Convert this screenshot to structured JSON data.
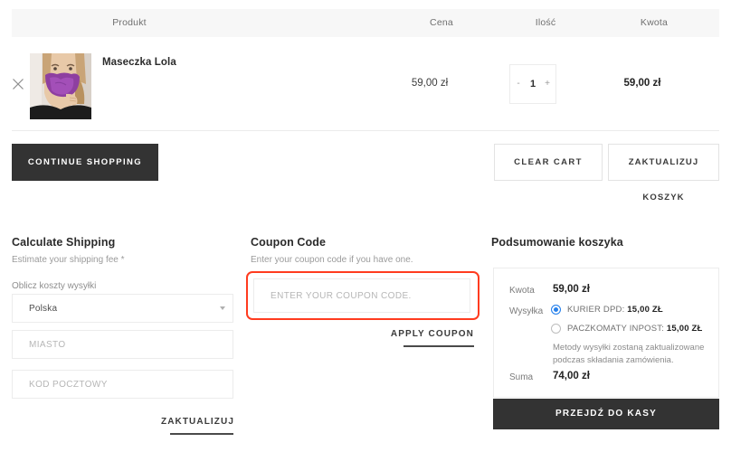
{
  "cart_table": {
    "columns": [
      "Produkt",
      "Cena",
      "Ilość",
      "Kwota"
    ],
    "rows": [
      {
        "remove_icon": "close-x-icon",
        "name": "Maseczka Lola",
        "price": "59,00 zł",
        "quantity": "1",
        "qty_minus": "-",
        "qty_plus": "+",
        "subtotal": "59,00 zł"
      }
    ]
  },
  "actions": {
    "continue_shopping": "CONTINUE SHOPPING",
    "clear_cart": "CLEAR CART",
    "update_cart": "ZAKTUALIZUJ KOSZYK"
  },
  "shipping": {
    "title": "Calculate Shipping",
    "subtitle": "Estimate your shipping fee *",
    "country_label": "Oblicz koszty wysyłki",
    "country_value": "Polska",
    "city_placeholder": "MIASTO",
    "postal_placeholder": "KOD POCZTOWY",
    "update_label": "ZAKTUALIZUJ"
  },
  "coupon": {
    "title": "Coupon Code",
    "subtitle": "Enter your coupon code if you have one.",
    "input_placeholder": "ENTER YOUR COUPON CODE.",
    "input_value": "",
    "apply_label": "APPLY COUPON",
    "highlight_color": "#ff3b1f"
  },
  "summary": {
    "title": "Podsumowanie koszyka",
    "subtotal_label": "Kwota",
    "subtotal_value": "59,00 zł",
    "shipping_label": "Wysyłka",
    "shipping_options": [
      {
        "label_prefix": "KURIER DPD: ",
        "price": "15,00 ZŁ",
        "selected": true
      },
      {
        "label_prefix": "PACZKOMATY INPOST: ",
        "price": "15,00 ZŁ",
        "selected": false
      }
    ],
    "note": "Metody wysyłki zostaną zaktualizowane podczas składania zamówienia.",
    "total_label": "Suma",
    "total_value": "74,00 zł",
    "checkout_label": "PRZEJDŹ DO KASY",
    "accent_color": "#2680eb"
  }
}
